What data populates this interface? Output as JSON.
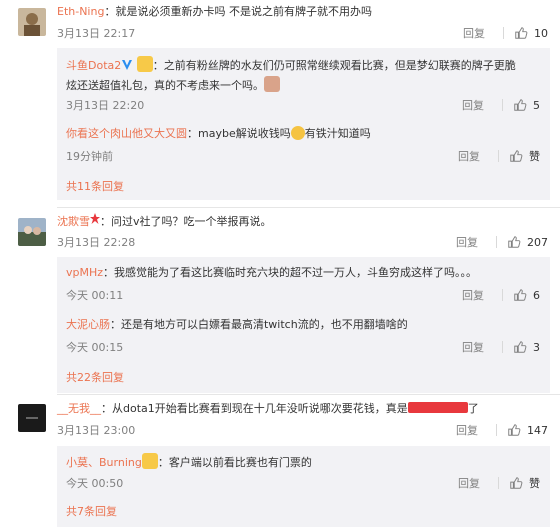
{
  "labels": {
    "reply": "回复"
  },
  "comments": [
    {
      "user": "Eth-Ning",
      "sep": "：",
      "text": "就是说必须重新办卡吗 不是说之前有牌子就不用办吗",
      "time": "3月13日 22:17",
      "likes": "10",
      "replies": [
        {
          "user": "斗鱼Dota2",
          "text_before": "：之前有粉丝牌的水友们仍可照常继续观看比赛，但是梦幻联赛的牌子更脆",
          "text_line2": "炫还送超值礼包，真的不考虑来一个吗。",
          "time": "3月13日 22:20",
          "likes": "5"
        },
        {
          "user": "你看这个肉山他又大又圆",
          "text_before": "：maybe解说收钱吗",
          "text_after": "有铁汁知道吗",
          "time": "19分钟前",
          "likes": "赞"
        }
      ],
      "more": "共11条回复"
    },
    {
      "user": "沈欺雪",
      "sep": "：",
      "text": "问过v社了吗？吃一个举报再说。",
      "time": "3月13日 22:28",
      "likes": "207",
      "replies": [
        {
          "user": "vpMHz",
          "text_before": "：我感觉能为了看这比赛临时充六块的超不过一万人，斗鱼穷成这样了吗。。。",
          "time": "今天 00:11",
          "likes": "6"
        },
        {
          "user": "大泥心肠",
          "text_before": "：还是有地方可以白嫖看最高清twitch流的，也不用翻墙啥的",
          "time": "今天 00:15",
          "likes": "3"
        }
      ],
      "more": "共22条回复"
    },
    {
      "user": "__无我__",
      "sep": "：",
      "text": "从dota1开始看比赛看到现在十几年没听说哪次要花钱，真是",
      "text_after": "了",
      "time": "3月13日 23:00",
      "likes": "147",
      "replies": [
        {
          "user": "小莫、Burning",
          "text_before": "：客户端以前看比赛也有门票的",
          "time": "今天 00:50",
          "likes": "赞"
        }
      ],
      "more": "共7条回复"
    }
  ]
}
